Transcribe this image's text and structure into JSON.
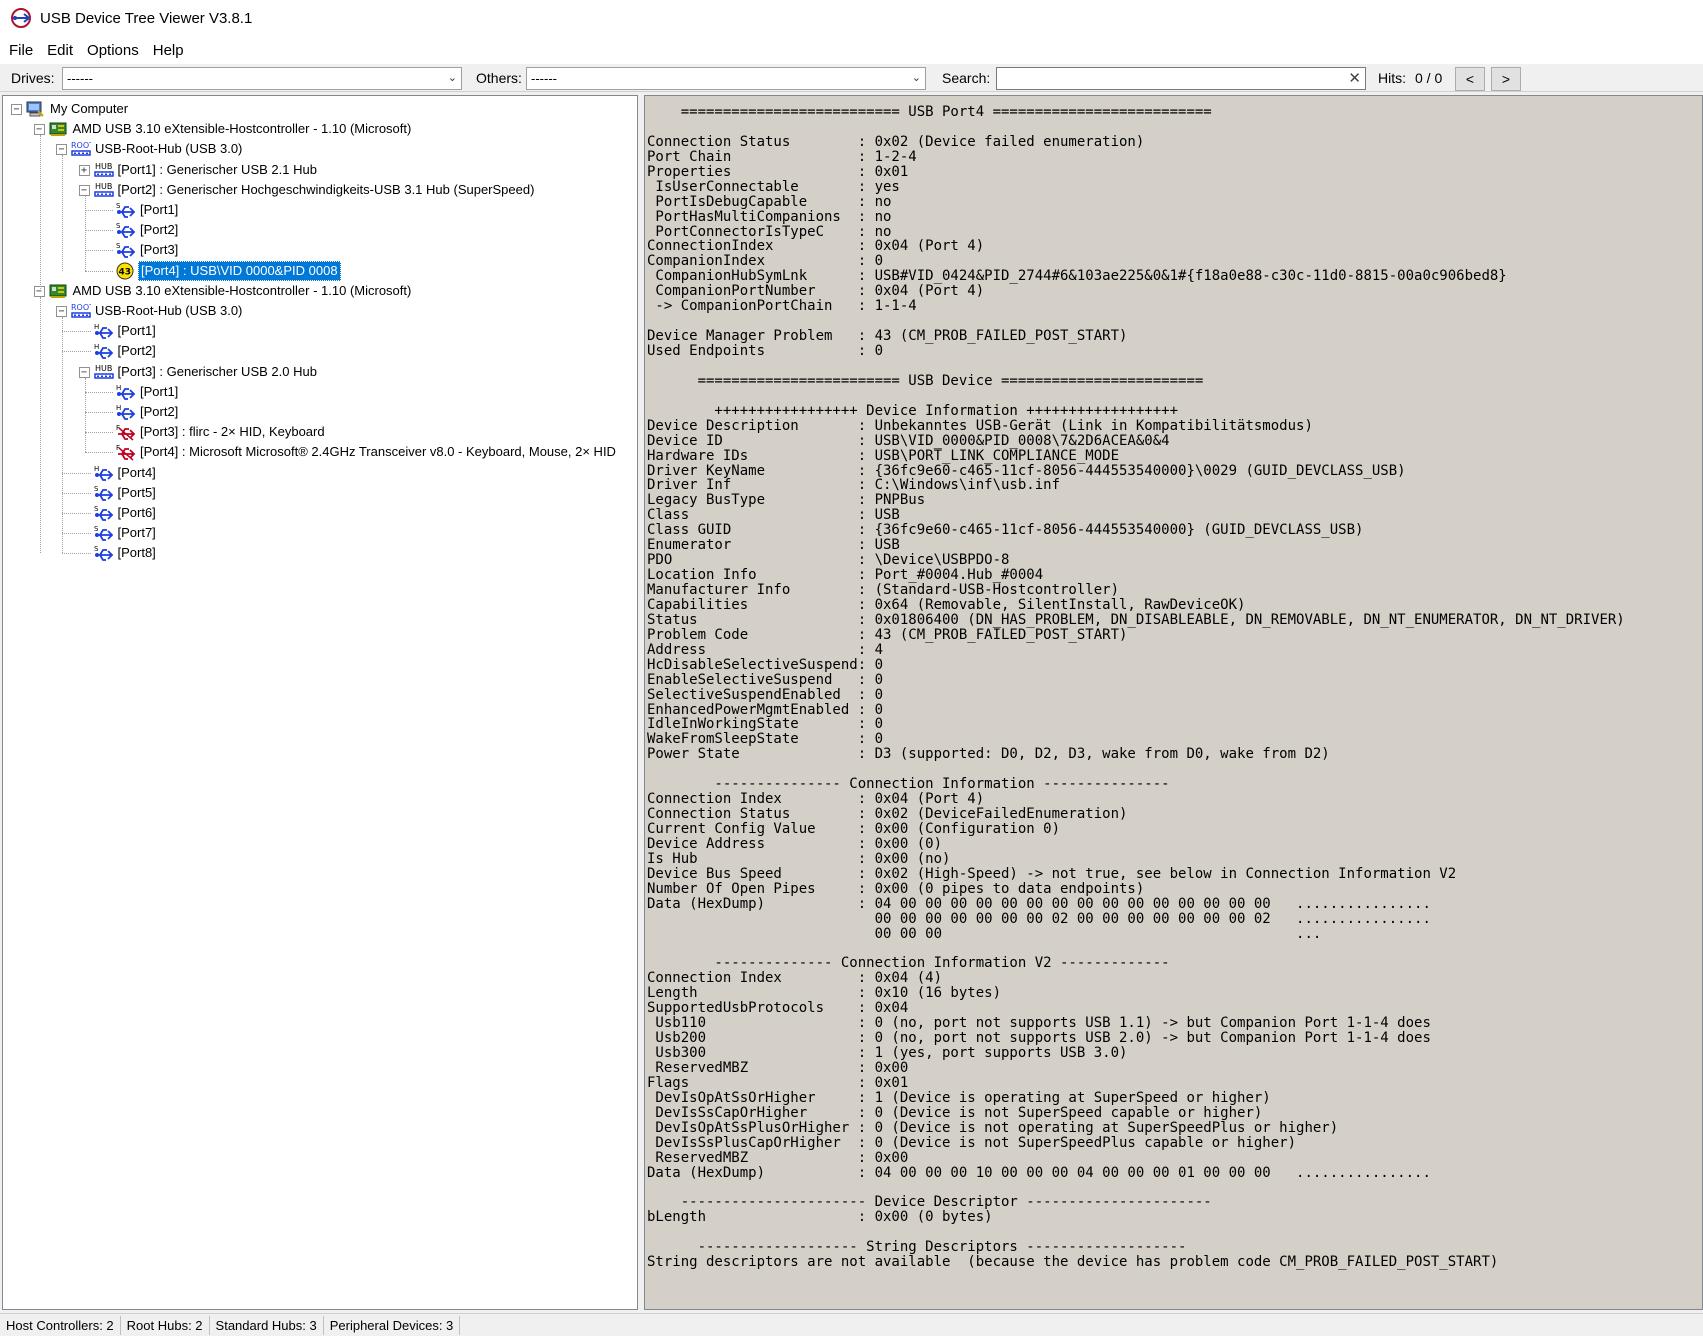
{
  "window": {
    "title": "USB Device Tree Viewer V3.8.1"
  },
  "menu": {
    "items": [
      "File",
      "Edit",
      "Options",
      "Help"
    ]
  },
  "toolbar": {
    "drives_label": "Drives:",
    "drives_value": "------",
    "others_label": "Others:",
    "others_value": "------",
    "search_label": "Search:",
    "search_value": "",
    "hits_label": "Hits:",
    "hits_value": "0 / 0",
    "prev_label": "<",
    "next_label": ">"
  },
  "tree": {
    "nodes": [
      {
        "label": "My Computer",
        "icon": "computer-icon"
      },
      {
        "label": "AMD USB 3.10 eXtensible-Hostcontroller - 1.10 (Microsoft)",
        "icon": "host-controller-icon"
      },
      {
        "label": "USB-Root-Hub (USB 3.0)",
        "icon": "root-hub-icon",
        "icon_text": "ROOT"
      },
      {
        "label": "[Port1] : Generischer USB 2.1 Hub",
        "icon": "hub-icon",
        "icon_text": "HUB"
      },
      {
        "label": "[Port2] : Generischer Hochgeschwindigkeits-USB 3.1 Hub (SuperSpeed)",
        "icon": "hub-icon",
        "icon_text": "HUB"
      },
      {
        "label": "[Port1]",
        "icon": "usb-port-icon",
        "icon_text": "S"
      },
      {
        "label": "[Port2]",
        "icon": "usb-port-icon",
        "icon_text": "S"
      },
      {
        "label": "[Port3]",
        "icon": "usb-port-icon",
        "icon_text": "S"
      },
      {
        "label": "[Port4] : USB\\VID 0000&PID 0008",
        "icon": "warning-icon",
        "icon_text": "43"
      },
      {
        "label": "AMD USB 3.10 eXtensible-Hostcontroller - 1.10 (Microsoft)",
        "icon": "host-controller-icon"
      },
      {
        "label": "USB-Root-Hub (USB 3.0)",
        "icon": "root-hub-icon",
        "icon_text": "ROOT"
      },
      {
        "label": "[Port1]",
        "icon": "usb-port-icon",
        "icon_text": "H"
      },
      {
        "label": "[Port2]",
        "icon": "usb-port-icon",
        "icon_text": "H"
      },
      {
        "label": "[Port3] : Generischer USB 2.0 Hub",
        "icon": "hub-icon",
        "icon_text": "HUB"
      },
      {
        "label": "[Port1]",
        "icon": "usb-port-icon",
        "icon_text": "H"
      },
      {
        "label": "[Port2]",
        "icon": "usb-port-icon",
        "icon_text": "H"
      },
      {
        "label": "[Port3] : flirc - 2× HID, Keyboard",
        "icon": "usb-device-disabled-icon",
        "icon_text": "F"
      },
      {
        "label": "[Port4] : Microsoft Microsoft® 2.4GHz Transceiver v8.0 - Keyboard, Mouse, 2× HID",
        "icon": "usb-device-disabled-icon",
        "icon_text": "F"
      },
      {
        "label": "[Port4]",
        "icon": "usb-port-icon",
        "icon_text": "H"
      },
      {
        "label": "[Port5]",
        "icon": "usb-port-icon",
        "icon_text": "S"
      },
      {
        "label": "[Port6]",
        "icon": "usb-port-icon",
        "icon_text": "S"
      },
      {
        "label": "[Port7]",
        "icon": "usb-port-icon",
        "icon_text": "S"
      },
      {
        "label": "[Port8]",
        "icon": "usb-port-icon",
        "icon_text": "S"
      }
    ]
  },
  "detail": {
    "lines": [
      "    ========================== USB Port4 ==========================",
      "",
      "Connection Status        : 0x02 (Device failed enumeration)",
      "Port Chain               : 1-2-4",
      "Properties               : 0x01",
      " IsUserConnectable       : yes",
      " PortIsDebugCapable      : no",
      " PortHasMultiCompanions  : no",
      " PortConnectorIsTypeC    : no",
      "ConnectionIndex          : 0x04 (Port 4)",
      "CompanionIndex           : 0",
      " CompanionHubSymLnk      : USB#VID_0424&PID_2744#6&103ae225&0&1#{f18a0e88-c30c-11d0-8815-00a0c906bed8}",
      " CompanionPortNumber     : 0x04 (Port 4)",
      " -> CompanionPortChain   : 1-1-4",
      "",
      "Device Manager Problem   : 43 (CM_PROB_FAILED_POST_START)",
      "Used Endpoints           : 0",
      "",
      "      ======================== USB Device ========================",
      "",
      "        +++++++++++++++++ Device Information ++++++++++++++++++",
      "Device Description       : Unbekanntes USB-Gerät (Link in Kompatibilitätsmodus)",
      "Device ID                : USB\\VID_0000&PID_0008\\7&2D6ACEA&0&4",
      "Hardware IDs             : USB\\PORT_LINK_COMPLIANCE_MODE",
      "Driver KeyName           : {36fc9e60-c465-11cf-8056-444553540000}\\0029 (GUID_DEVCLASS_USB)",
      "Driver Inf               : C:\\Windows\\inf\\usb.inf",
      "Legacy BusType           : PNPBus",
      "Class                    : USB",
      "Class GUID               : {36fc9e60-c465-11cf-8056-444553540000} (GUID_DEVCLASS_USB)",
      "Enumerator               : USB",
      "PDO                      : \\Device\\USBPDO-8",
      "Location Info            : Port_#0004.Hub_#0004",
      "Manufacturer Info        : (Standard-USB-Hostcontroller)",
      "Capabilities             : 0x64 (Removable, SilentInstall, RawDeviceOK)",
      "Status                   : 0x01806400 (DN_HAS_PROBLEM, DN_DISABLEABLE, DN_REMOVABLE, DN_NT_ENUMERATOR, DN_NT_DRIVER)",
      "Problem Code             : 43 (CM_PROB_FAILED_POST_START)",
      "Address                  : 4",
      "HcDisableSelectiveSuspend: 0",
      "EnableSelectiveSuspend   : 0",
      "SelectiveSuspendEnabled  : 0",
      "EnhancedPowerMgmtEnabled : 0",
      "IdleInWorkingState       : 0",
      "WakeFromSleepState       : 0",
      "Power State              : D3 (supported: D0, D2, D3, wake from D0, wake from D2)",
      "",
      "        --------------- Connection Information ---------------",
      "Connection Index         : 0x04 (Port 4)",
      "Connection Status        : 0x02 (DeviceFailedEnumeration)",
      "Current Config Value     : 0x00 (Configuration 0)",
      "Device Address           : 0x00 (0)",
      "Is Hub                   : 0x00 (no)",
      "Device Bus Speed         : 0x02 (High-Speed) -> not true, see below in Connection Information V2",
      "Number Of Open Pipes     : 0x00 (0 pipes to data endpoints)",
      "Data (HexDump)           : 04 00 00 00 00 00 00 00 00 00 00 00 00 00 00 00   ................",
      "                           00 00 00 00 00 00 00 02 00 00 00 00 00 00 00 02   ................",
      "                           00 00 00                                          ...",
      "",
      "        -------------- Connection Information V2 -------------",
      "Connection Index         : 0x04 (4)",
      "Length                   : 0x10 (16 bytes)",
      "SupportedUsbProtocols    : 0x04",
      " Usb110                  : 0 (no, port not supports USB 1.1) -> but Companion Port 1-1-4 does",
      " Usb200                  : 0 (no, port not supports USB 2.0) -> but Companion Port 1-1-4 does",
      " Usb300                  : 1 (yes, port supports USB 3.0)",
      " ReservedMBZ             : 0x00",
      "Flags                    : 0x01",
      " DevIsOpAtSsOrHigher     : 1 (Device is operating at SuperSpeed or higher)",
      " DevIsSsCapOrHigher      : 0 (Device is not SuperSpeed capable or higher)",
      " DevIsOpAtSsPlusOrHigher : 0 (Device is not operating at SuperSpeedPlus or higher)",
      " DevIsSsPlusCapOrHigher  : 0 (Device is not SuperSpeedPlus capable or higher)",
      " ReservedMBZ             : 0x00",
      "Data (HexDump)           : 04 00 00 00 10 00 00 00 04 00 00 00 01 00 00 00   ................",
      "",
      "    ---------------------- Device Descriptor ----------------------",
      "bLength                  : 0x00 (0 bytes)",
      "",
      "      ------------------- String Descriptors -------------------",
      "String descriptors are not available  (because the device has problem code CM_PROB_FAILED_POST_START)"
    ]
  },
  "status": {
    "items": [
      "Host Controllers: 2",
      "Root Hubs: 2",
      "Standard Hubs: 3",
      "Peripheral Devices: 3"
    ]
  },
  "colors": {
    "selection": "#0078d7",
    "usb_blue": "#1d3fe0",
    "warning_yellow": "#ffe100",
    "detail_bg": "#d4d0c8"
  }
}
